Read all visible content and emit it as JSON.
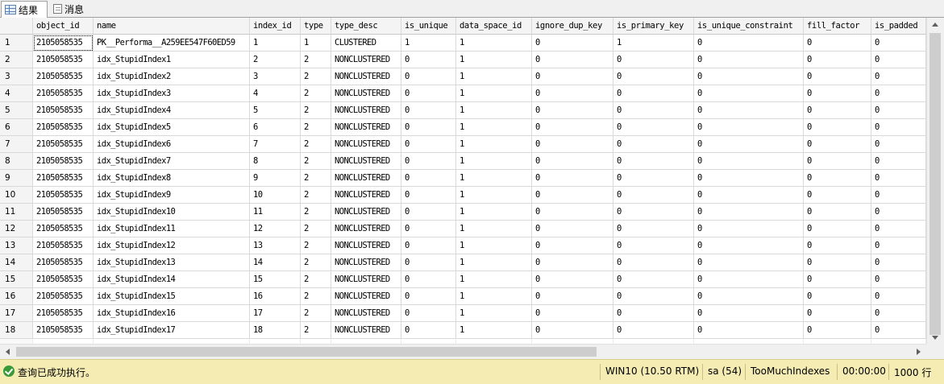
{
  "tabs": [
    {
      "label": "结果",
      "icon": "grid-icon",
      "active": true
    },
    {
      "label": "消息",
      "icon": "message-icon",
      "active": false
    }
  ],
  "columns": [
    "object_id",
    "name",
    "index_id",
    "type",
    "type_desc",
    "is_unique",
    "data_space_id",
    "ignore_dup_key",
    "is_primary_key",
    "is_unique_constraint",
    "fill_factor",
    "is_padded"
  ],
  "rows": [
    {
      "n": "1",
      "c": [
        "2105058535",
        "PK__Performa__A259EE547F60ED59",
        "1",
        "1",
        "CLUSTERED",
        "1",
        "1",
        "0",
        "1",
        "0",
        "0",
        "0"
      ]
    },
    {
      "n": "2",
      "c": [
        "2105058535",
        "idx_StupidIndex1",
        "2",
        "2",
        "NONCLUSTERED",
        "0",
        "1",
        "0",
        "0",
        "0",
        "0",
        "0"
      ]
    },
    {
      "n": "3",
      "c": [
        "2105058535",
        "idx_StupidIndex2",
        "3",
        "2",
        "NONCLUSTERED",
        "0",
        "1",
        "0",
        "0",
        "0",
        "0",
        "0"
      ]
    },
    {
      "n": "4",
      "c": [
        "2105058535",
        "idx_StupidIndex3",
        "4",
        "2",
        "NONCLUSTERED",
        "0",
        "1",
        "0",
        "0",
        "0",
        "0",
        "0"
      ]
    },
    {
      "n": "5",
      "c": [
        "2105058535",
        "idx_StupidIndex4",
        "5",
        "2",
        "NONCLUSTERED",
        "0",
        "1",
        "0",
        "0",
        "0",
        "0",
        "0"
      ]
    },
    {
      "n": "6",
      "c": [
        "2105058535",
        "idx_StupidIndex5",
        "6",
        "2",
        "NONCLUSTERED",
        "0",
        "1",
        "0",
        "0",
        "0",
        "0",
        "0"
      ]
    },
    {
      "n": "7",
      "c": [
        "2105058535",
        "idx_StupidIndex6",
        "7",
        "2",
        "NONCLUSTERED",
        "0",
        "1",
        "0",
        "0",
        "0",
        "0",
        "0"
      ]
    },
    {
      "n": "8",
      "c": [
        "2105058535",
        "idx_StupidIndex7",
        "8",
        "2",
        "NONCLUSTERED",
        "0",
        "1",
        "0",
        "0",
        "0",
        "0",
        "0"
      ]
    },
    {
      "n": "9",
      "c": [
        "2105058535",
        "idx_StupidIndex8",
        "9",
        "2",
        "NONCLUSTERED",
        "0",
        "1",
        "0",
        "0",
        "0",
        "0",
        "0"
      ]
    },
    {
      "n": "10",
      "c": [
        "2105058535",
        "idx_StupidIndex9",
        "10",
        "2",
        "NONCLUSTERED",
        "0",
        "1",
        "0",
        "0",
        "0",
        "0",
        "0"
      ]
    },
    {
      "n": "11",
      "c": [
        "2105058535",
        "idx_StupidIndex10",
        "11",
        "2",
        "NONCLUSTERED",
        "0",
        "1",
        "0",
        "0",
        "0",
        "0",
        "0"
      ]
    },
    {
      "n": "12",
      "c": [
        "2105058535",
        "idx_StupidIndex11",
        "12",
        "2",
        "NONCLUSTERED",
        "0",
        "1",
        "0",
        "0",
        "0",
        "0",
        "0"
      ]
    },
    {
      "n": "13",
      "c": [
        "2105058535",
        "idx_StupidIndex12",
        "13",
        "2",
        "NONCLUSTERED",
        "0",
        "1",
        "0",
        "0",
        "0",
        "0",
        "0"
      ]
    },
    {
      "n": "14",
      "c": [
        "2105058535",
        "idx_StupidIndex13",
        "14",
        "2",
        "NONCLUSTERED",
        "0",
        "1",
        "0",
        "0",
        "0",
        "0",
        "0"
      ]
    },
    {
      "n": "15",
      "c": [
        "2105058535",
        "idx_StupidIndex14",
        "15",
        "2",
        "NONCLUSTERED",
        "0",
        "1",
        "0",
        "0",
        "0",
        "0",
        "0"
      ]
    },
    {
      "n": "16",
      "c": [
        "2105058535",
        "idx_StupidIndex15",
        "16",
        "2",
        "NONCLUSTERED",
        "0",
        "1",
        "0",
        "0",
        "0",
        "0",
        "0"
      ]
    },
    {
      "n": "17",
      "c": [
        "2105058535",
        "idx_StupidIndex16",
        "17",
        "2",
        "NONCLUSTERED",
        "0",
        "1",
        "0",
        "0",
        "0",
        "0",
        "0"
      ]
    },
    {
      "n": "18",
      "c": [
        "2105058535",
        "idx_StupidIndex17",
        "18",
        "2",
        "NONCLUSTERED",
        "0",
        "1",
        "0",
        "0",
        "0",
        "0",
        "0"
      ]
    }
  ],
  "status": {
    "icon": "success-check-icon",
    "message": "查询已成功执行。",
    "server": "WIN10 (10.50 RTM)",
    "user": "sa (54)",
    "database": "TooMuchIndexes",
    "elapsed": "00:00:00",
    "row_count": "1000 行",
    "background_color": "#f4ecb2",
    "ok_color": "#3a9a3a"
  }
}
